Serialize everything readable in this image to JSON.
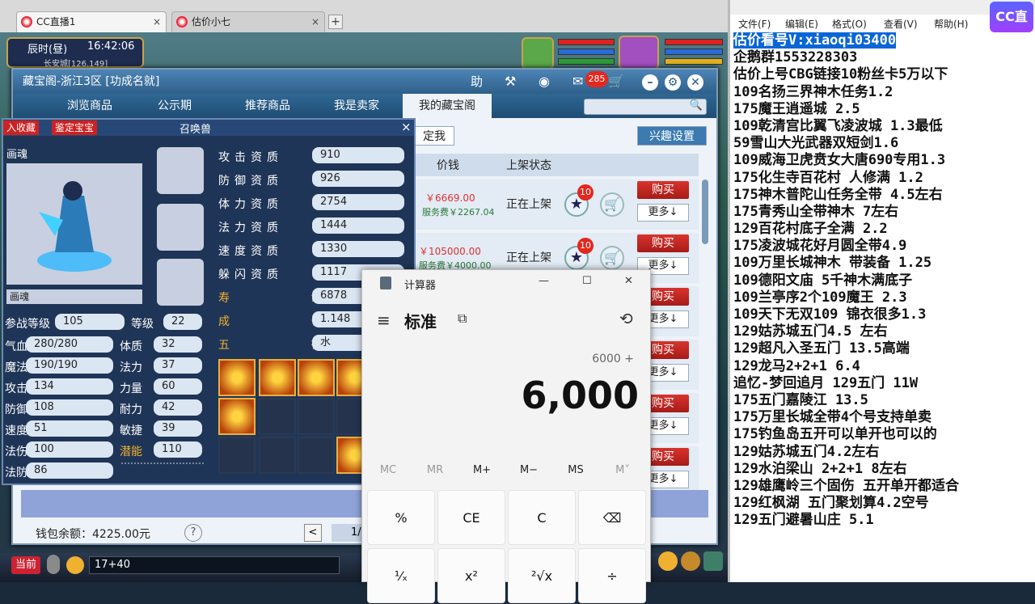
{
  "browser": {
    "tabs": [
      {
        "label": "CC直播1",
        "close": "×"
      },
      {
        "label": "估价小七",
        "close": "×"
      }
    ],
    "new_tab": "+"
  },
  "game": {
    "time_label": "辰时(昼)",
    "clock": "16:42:06",
    "location": "长安城[126,149]",
    "bottom_left": "当前",
    "chat_input": "17+40"
  },
  "cbg": {
    "title": "藏宝阁-浙江3区 [功成名就]",
    "title_buttons": {
      "help": "助",
      "notifications": "285"
    },
    "tabs": [
      "浏览商品",
      "公示期",
      "推荐商品",
      "我是卖家",
      "我的藏宝阁"
    ],
    "active_tab": 4,
    "filter_button": "定我",
    "interest_button": "兴趣设置",
    "columns": [
      "价钱",
      "上架状态"
    ],
    "rows": [
      {
        "price": "￥6669.00",
        "fee": "服务费￥2267.04",
        "status": "正在上架",
        "fav_count": "10"
      },
      {
        "price": "￥105000.00",
        "fee": "服务费￥4000.00",
        "status": "正在上架",
        "fav_count": "10"
      }
    ],
    "buy_label": "购买",
    "more_label": "更多↓",
    "wallet": "钱包余额：4225.00元",
    "help_icon": "?",
    "page_prev": "<",
    "page_num": "1/"
  },
  "pet": {
    "tags": [
      "入收藏",
      "鉴定宝宝"
    ],
    "header": "召唤兽",
    "close": "×",
    "name": "画魂",
    "name_field": "画魂",
    "left_stats": [
      {
        "label": "参战等级",
        "value": "105"
      },
      {
        "label": "气血",
        "value": "280/280"
      },
      {
        "label": "魔法",
        "value": "190/190"
      },
      {
        "label": "攻击",
        "value": "134"
      },
      {
        "label": "防御",
        "value": "108"
      },
      {
        "label": "速度",
        "value": "51"
      },
      {
        "label": "法伤",
        "value": "100"
      },
      {
        "label": "法防",
        "value": "86"
      }
    ],
    "mid_stats": [
      {
        "label": "等级",
        "value": "22"
      },
      {
        "label": "体质",
        "value": "32"
      },
      {
        "label": "法力",
        "value": "37"
      },
      {
        "label": "力量",
        "value": "60"
      },
      {
        "label": "耐力",
        "value": "42"
      },
      {
        "label": "敏捷",
        "value": "39"
      },
      {
        "label": "潜能",
        "value": "110"
      }
    ],
    "aptitudes": [
      {
        "label": "攻击资质",
        "value": "910"
      },
      {
        "label": "防御资质",
        "value": "926"
      },
      {
        "label": "体力资质",
        "value": "2754"
      },
      {
        "label": "法力资质",
        "value": "1444"
      },
      {
        "label": "速度资质",
        "value": "1330"
      },
      {
        "label": "躲闪资质",
        "value": "1117"
      },
      {
        "label": "寿 命",
        "value": "6878"
      },
      {
        "label": "成 长",
        "value": "1.148"
      },
      {
        "label": "五 行",
        "value": "水"
      }
    ]
  },
  "calculator": {
    "title": "计算器",
    "mode": "标准",
    "expression": "6000 +",
    "display": "6,000",
    "memory_keys": [
      "MC",
      "MR",
      "M+",
      "M−",
      "MS",
      "M˅"
    ],
    "keys_row1": [
      "%",
      "CE",
      "C",
      "⌫"
    ],
    "keys_row2": [
      "¹⁄ₓ",
      "x²",
      "²√x",
      "÷"
    ],
    "window_buttons": [
      "—",
      "☐",
      "✕"
    ]
  },
  "notepad": {
    "menu": [
      "文件(F)",
      "编辑(E)",
      "格式(O)",
      "查看(V)",
      "帮助(H)"
    ],
    "lines": [
      "估价看号V:xiaoqi03400",
      "企鹅群1553228303",
      "估价上号CBG链接10粉丝卡5万以下",
      "109名扬三界神木任务1.2",
      "175魔王逍遥城 2.5",
      "109乾清宫比翼飞凌波城 1.3最低",
      "59雪山大光武器双短剑1.6",
      "109威海卫虎贲女大唐690专用1.3",
      "175化生寺百花村 人修满 1.2",
      "175神木普陀山任务全带 4.5左右",
      "175青秀山全带神木  7左右",
      "129百花村底子全满 2.2",
      "175凌波城花好月圆全带4.9",
      "109万里长城神木 带装备  1.25",
      "109德阳文庙 5千神木满底子",
      "109兰亭序2个109魔王 2.3",
      "109天下无双109  锦衣很多1.3",
      "129姑苏城五门4.5 左右",
      "129超凡入圣五门  13.5高端",
      "129龙马2+2+1  6.4",
      "追忆-梦回追月 129五门 11W",
      "175五门嘉陵江 13.5",
      "175万里长城全带4个号支持单卖",
      "175钓鱼岛五开可以单开也可以的",
      "129姑苏城五门4.2左右",
      "129水泊梁山 2+2+1 8左右",
      "129雄鹰岭三个固伤 五开单开都适合",
      "129红枫湖 五门聚划算4.2空号",
      "129五门避暑山庄  5.1"
    ]
  },
  "logo_text": "CC直播"
}
